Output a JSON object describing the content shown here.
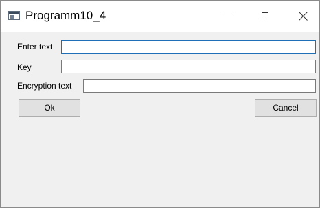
{
  "window": {
    "title": "Programm10_4",
    "controls": {
      "minimize_icon": "minimize-icon",
      "maximize_icon": "maximize-icon",
      "close_icon": "close-icon"
    }
  },
  "form": {
    "enter_text": {
      "label": "Enter text",
      "value": ""
    },
    "key": {
      "label": "Key",
      "value": ""
    },
    "encryption_text": {
      "label": "Encryption text",
      "value": ""
    }
  },
  "buttons": {
    "ok_label": "Ok",
    "cancel_label": "Cancel"
  },
  "colors": {
    "focus_border": "#1e6fb5",
    "client_background": "#f0f0f0",
    "button_face": "#e1e1e1"
  }
}
